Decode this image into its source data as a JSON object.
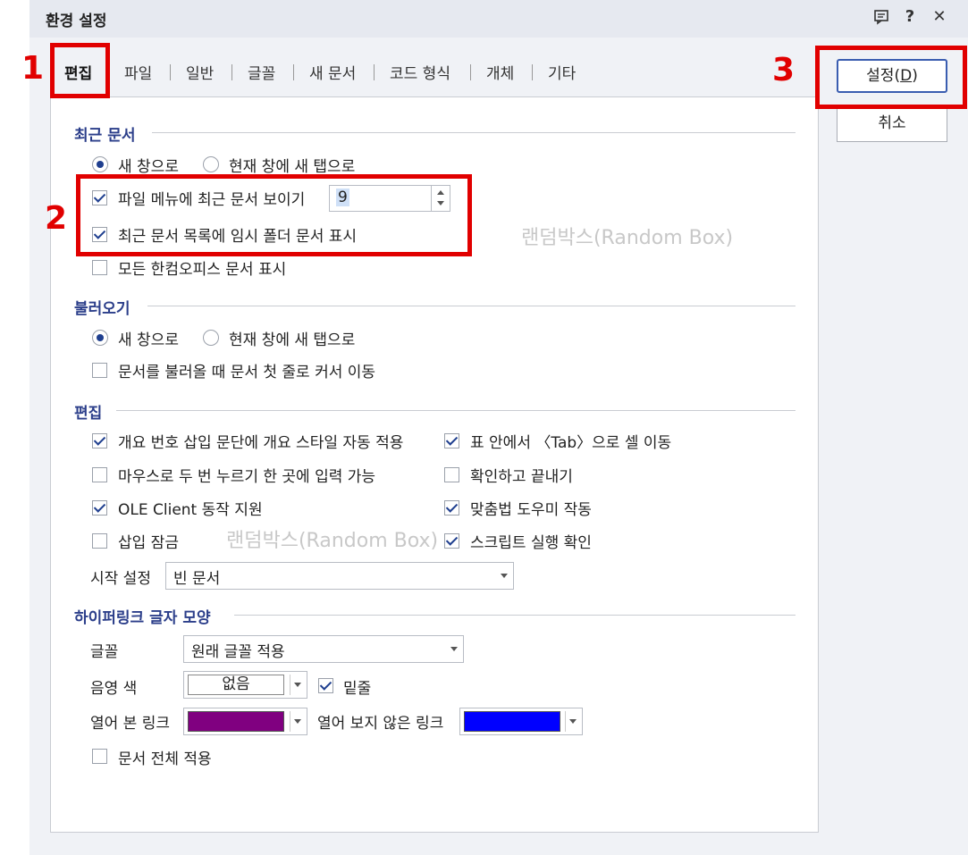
{
  "window": {
    "title": "환경 설정",
    "icons": [
      "comment-icon",
      "help-icon",
      "close-icon"
    ],
    "help_glyph": "?",
    "close_glyph": "✕"
  },
  "tabs": [
    {
      "label": "편집",
      "active": true
    },
    {
      "label": "파일"
    },
    {
      "label": "일반"
    },
    {
      "label": "글꼴"
    },
    {
      "label": "새 문서"
    },
    {
      "label": "코드 형식"
    },
    {
      "label": "개체"
    },
    {
      "label": "기타"
    }
  ],
  "buttons": {
    "ok": "설정(",
    "ok_key": "D",
    "ok_close": ")",
    "cancel": "취소"
  },
  "recent": {
    "title": "최근 문서",
    "radio_new_window": "새 창으로",
    "radio_new_tab": "현재 창에 새 탭으로",
    "show_recent": "파일 메뉴에 최근 문서 보이기",
    "recent_count": "9",
    "show_temp": "최근 문서 목록에 임시 폴더 문서 표시",
    "show_all": "모든 한컴오피스 문서 표시"
  },
  "open": {
    "title": "불러오기",
    "radio_new_window": "새 창으로",
    "radio_new_tab": "현재 창에 새 탭으로",
    "move_cursor": "문서를 불러올 때 문서 첫 줄로 커서 이동"
  },
  "edit": {
    "title": "편집",
    "auto_outline": "개요 번호 삽입 문단에 개요 스타일 자동 적용",
    "tab_move": "표 안에서 〈Tab〉으로 셀 이동",
    "double_click": "마우스로 두 번 누르기 한 곳에 입력 가능",
    "confirm_exit": "확인하고 끝내기",
    "ole_client": "OLE Client 동작 지원",
    "spell_helper": "맞춤법 도우미 작동",
    "insert_lock": "삽입 잠금",
    "script_confirm": "스크립트 실행 확인",
    "start_label": "시작 설정",
    "start_value": "빈 문서"
  },
  "hyperlink": {
    "title": "하이퍼링크 글자 모양",
    "font_label": "글꼴",
    "font_value": "원래 글꼴 적용",
    "shade_label": "음영 색",
    "shade_value": "없음",
    "underline": "밑줄",
    "visited_label": "열어 본 링크",
    "visited_color": "#800080",
    "unvisited_label": "열어 보지 않은 링크",
    "unvisited_color": "#0000ff",
    "apply_all": "문서 전체 적용"
  },
  "annotations": {
    "n1": "1",
    "n2": "2",
    "n3": "3",
    "color": "#e10000"
  },
  "watermark": "랜덤박스(Random Box)"
}
